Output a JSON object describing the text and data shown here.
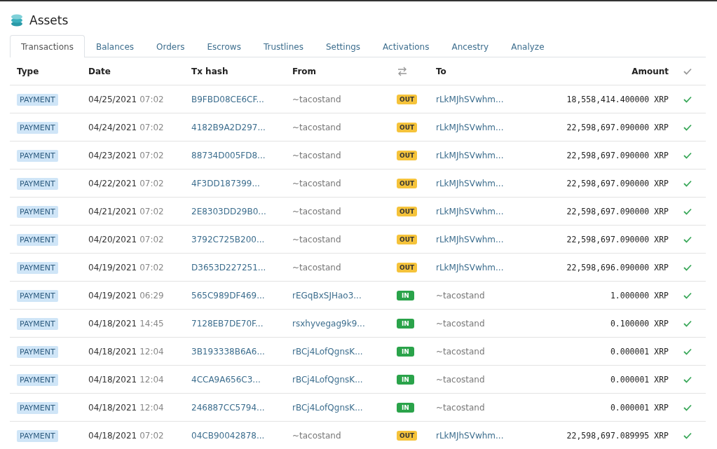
{
  "title": "Assets",
  "tabs": [
    {
      "label": "Transactions",
      "selected": true
    },
    {
      "label": "Balances",
      "selected": false
    },
    {
      "label": "Orders",
      "selected": false
    },
    {
      "label": "Escrows",
      "selected": false
    },
    {
      "label": "Trustlines",
      "selected": false
    },
    {
      "label": "Settings",
      "selected": false
    },
    {
      "label": "Activations",
      "selected": false
    },
    {
      "label": "Ancestry",
      "selected": false
    },
    {
      "label": "Analyze",
      "selected": false
    }
  ],
  "table": {
    "columns": [
      "Type",
      "Date",
      "Tx hash",
      "From",
      "To",
      "Amount"
    ],
    "rows": [
      {
        "type": "PAYMENT",
        "date": "04/25/2021",
        "time": "07:02",
        "hash": "B9FBD08CE6CF...",
        "from": "~tacostand",
        "from_link": false,
        "direction": "OUT",
        "to": "rLkMJhSVwhm...",
        "to_link": true,
        "amount": "18,558,414.400000 XRP",
        "success": true
      },
      {
        "type": "PAYMENT",
        "date": "04/24/2021",
        "time": "07:02",
        "hash": "4182B9A2D297...",
        "from": "~tacostand",
        "from_link": false,
        "direction": "OUT",
        "to": "rLkMJhSVwhm...",
        "to_link": true,
        "amount": "22,598,697.090000 XRP",
        "success": true
      },
      {
        "type": "PAYMENT",
        "date": "04/23/2021",
        "time": "07:02",
        "hash": "88734D005FD8...",
        "from": "~tacostand",
        "from_link": false,
        "direction": "OUT",
        "to": "rLkMJhSVwhm...",
        "to_link": true,
        "amount": "22,598,697.090000 XRP",
        "success": true
      },
      {
        "type": "PAYMENT",
        "date": "04/22/2021",
        "time": "07:02",
        "hash": "4F3DD187399...",
        "from": "~tacostand",
        "from_link": false,
        "direction": "OUT",
        "to": "rLkMJhSVwhm...",
        "to_link": true,
        "amount": "22,598,697.090000 XRP",
        "success": true
      },
      {
        "type": "PAYMENT",
        "date": "04/21/2021",
        "time": "07:02",
        "hash": "2E8303DD29B0...",
        "from": "~tacostand",
        "from_link": false,
        "direction": "OUT",
        "to": "rLkMJhSVwhm...",
        "to_link": true,
        "amount": "22,598,697.090000 XRP",
        "success": true
      },
      {
        "type": "PAYMENT",
        "date": "04/20/2021",
        "time": "07:02",
        "hash": "3792C725B200...",
        "from": "~tacostand",
        "from_link": false,
        "direction": "OUT",
        "to": "rLkMJhSVwhm...",
        "to_link": true,
        "amount": "22,598,697.090000 XRP",
        "success": true
      },
      {
        "type": "PAYMENT",
        "date": "04/19/2021",
        "time": "07:02",
        "hash": "D3653D227251...",
        "from": "~tacostand",
        "from_link": false,
        "direction": "OUT",
        "to": "rLkMJhSVwhm...",
        "to_link": true,
        "amount": "22,598,696.090000 XRP",
        "success": true
      },
      {
        "type": "PAYMENT",
        "date": "04/19/2021",
        "time": "06:29",
        "hash": "565C989DF469...",
        "from": "rEGqBxSJHao3...",
        "from_link": true,
        "direction": "IN",
        "to": "~tacostand",
        "to_link": false,
        "amount": "1.000000 XRP",
        "success": true
      },
      {
        "type": "PAYMENT",
        "date": "04/18/2021",
        "time": "14:45",
        "hash": "7128EB7DE70F...",
        "from": "rsxhyvegag9k9...",
        "from_link": true,
        "direction": "IN",
        "to": "~tacostand",
        "to_link": false,
        "amount": "0.100000 XRP",
        "success": true
      },
      {
        "type": "PAYMENT",
        "date": "04/18/2021",
        "time": "12:04",
        "hash": "3B193338B6A6...",
        "from": "rBCj4LofQgnsK...",
        "from_link": true,
        "direction": "IN",
        "to": "~tacostand",
        "to_link": false,
        "amount": "0.000001 XRP",
        "success": true
      },
      {
        "type": "PAYMENT",
        "date": "04/18/2021",
        "time": "12:04",
        "hash": "4CCA9A656C3...",
        "from": "rBCj4LofQgnsK...",
        "from_link": true,
        "direction": "IN",
        "to": "~tacostand",
        "to_link": false,
        "amount": "0.000001 XRP",
        "success": true
      },
      {
        "type": "PAYMENT",
        "date": "04/18/2021",
        "time": "12:04",
        "hash": "246887CC5794...",
        "from": "rBCj4LofQgnsK...",
        "from_link": true,
        "direction": "IN",
        "to": "~tacostand",
        "to_link": false,
        "amount": "0.000001 XRP",
        "success": true
      },
      {
        "type": "PAYMENT",
        "date": "04/18/2021",
        "time": "07:02",
        "hash": "04CB90042878...",
        "from": "~tacostand",
        "from_link": false,
        "direction": "OUT",
        "to": "rLkMJhSVwhm...",
        "to_link": true,
        "amount": "22,598,697.089995 XRP",
        "success": true
      }
    ]
  }
}
